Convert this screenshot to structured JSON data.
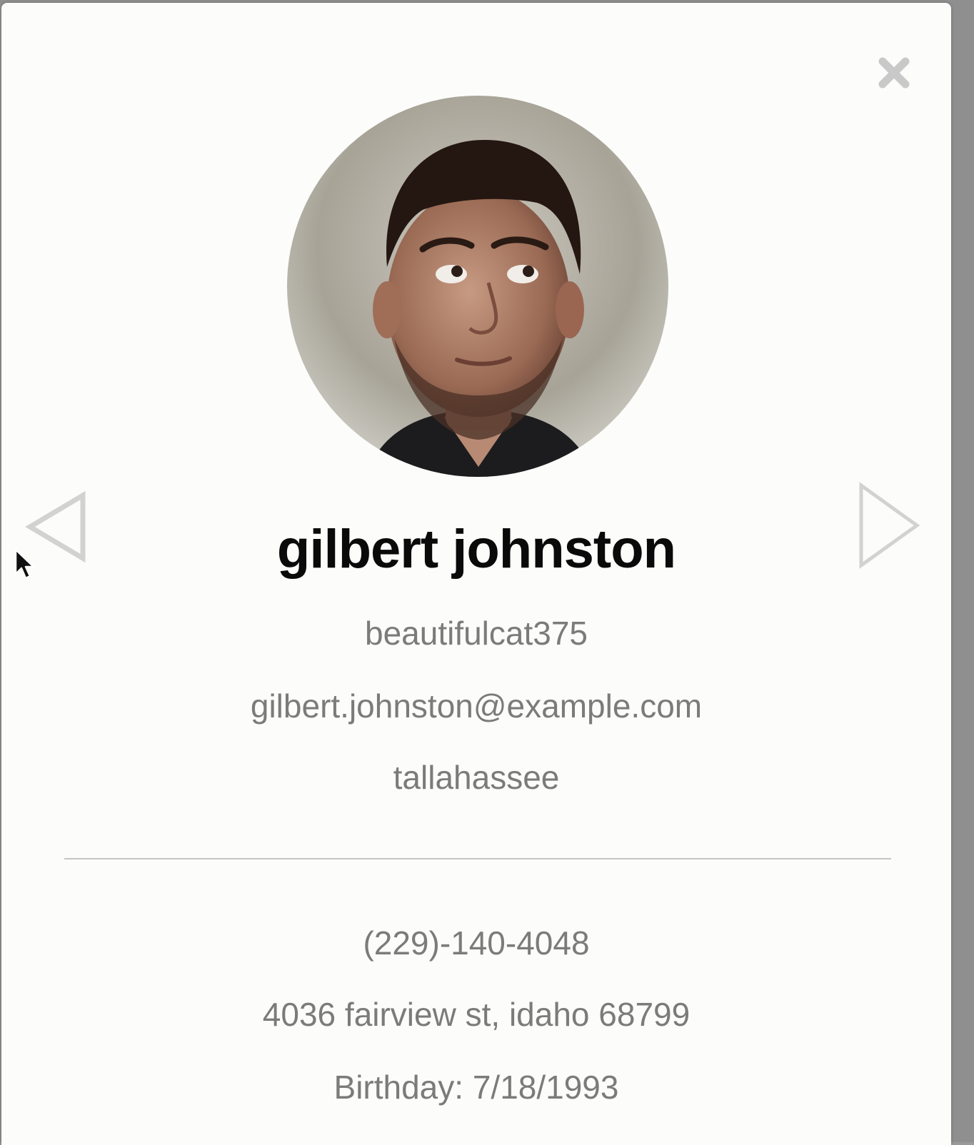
{
  "profile": {
    "name": "gilbert johnston",
    "username": "beautifulcat375",
    "email": "gilbert.johnston@example.com",
    "city": "tallahassee",
    "phone": "(229)-140-4048",
    "address": "4036 fairview st, idaho 68799",
    "birthday": "Birthday: 7/18/1993"
  },
  "icons": {
    "close": "close-icon",
    "previous": "triangle-left-icon",
    "next": "triangle-right-icon",
    "cursor": "mouse-pointer-icon"
  },
  "colors": {
    "modal_background": "#fcfcfa",
    "name_text": "#0a0a0a",
    "info_text": "#7b7b7b",
    "icon_gray": "#d2d2d2",
    "divider": "#c4c4c4"
  }
}
